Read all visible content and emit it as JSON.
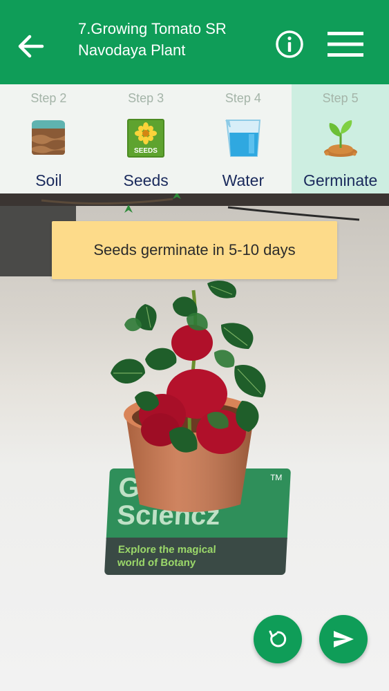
{
  "header": {
    "title_line1": "7.Growing Tomato SR",
    "title_line2": "Navodaya Plant"
  },
  "steps": [
    {
      "num": "Step 2",
      "label": "Soil",
      "icon": "soil-icon",
      "active": false
    },
    {
      "num": "Step 3",
      "label": "Seeds",
      "icon": "seeds-icon",
      "active": false
    },
    {
      "num": "Step 4",
      "label": "Water",
      "icon": "water-icon",
      "active": false
    },
    {
      "num": "Step 5",
      "label": "Germinate",
      "icon": "germinate-icon",
      "active": true
    }
  ],
  "seeds_packet_text": "SEEDS",
  "tooltip": "Seeds germinate in 5-10 days",
  "marker": {
    "brand_line1": "Green",
    "brand_line2": "Sciencz",
    "tm": "TM",
    "tagline_line1": "Explore the magical",
    "tagline_line2": "world of Botany"
  },
  "colors": {
    "primary": "#0f9d58",
    "active_step_bg": "#cdeee1",
    "tooltip_bg": "#fddb8a"
  }
}
